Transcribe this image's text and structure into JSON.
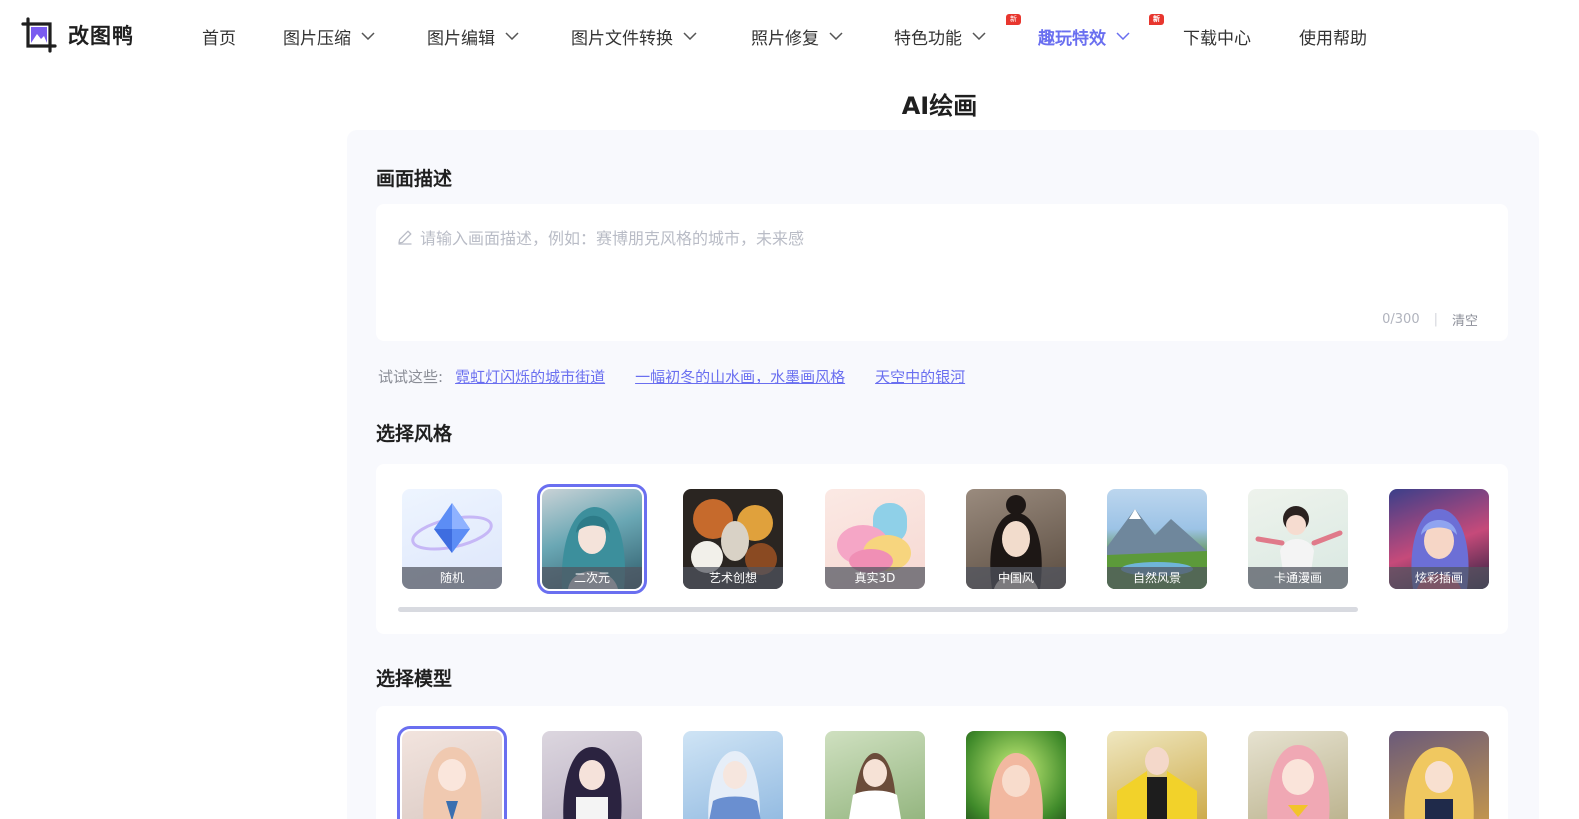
{
  "brand": {
    "name": "改图鸭"
  },
  "nav": {
    "items": [
      {
        "label": "首页"
      },
      {
        "label": "图片压缩"
      },
      {
        "label": "图片编辑"
      },
      {
        "label": "图片文件转换"
      },
      {
        "label": "照片修复"
      },
      {
        "label": "特色功能",
        "badge": "新"
      },
      {
        "label": "趣玩特效",
        "badge": "新"
      },
      {
        "label": "下载中心"
      },
      {
        "label": "使用帮助"
      }
    ],
    "active_color": "#6a6ff0"
  },
  "page": {
    "title": "AI绘画"
  },
  "description": {
    "title": "画面描述",
    "placeholder": "请输入画面描述，例如：赛博朋克风格的城市，未来感",
    "counter": "0/300",
    "clear_label": "清空"
  },
  "suggestions": {
    "label": "试试这些:",
    "items": [
      "霓虹灯闪烁的城市街道",
      "一幅初冬的山水画，水墨画风格",
      "天空中的银河"
    ]
  },
  "styles": {
    "title": "选择风格",
    "selected_index": 1,
    "items": [
      {
        "label": "随机"
      },
      {
        "label": "二次元"
      },
      {
        "label": "艺术创想"
      },
      {
        "label": "真实3D"
      },
      {
        "label": "中国风"
      },
      {
        "label": "自然风景"
      },
      {
        "label": "卡通漫画"
      },
      {
        "label": "炫彩插画"
      }
    ]
  },
  "models": {
    "title": "选择模型",
    "selected_index": 0
  }
}
